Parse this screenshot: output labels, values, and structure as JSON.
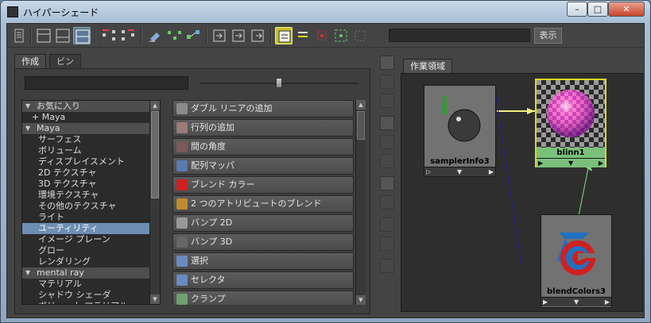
{
  "window": {
    "title": "ハイパーシェード",
    "controls": {
      "minimize": "–",
      "maximize": "□",
      "close": "✕"
    }
  },
  "toolbar": {
    "search_value": "",
    "show_label": "表示"
  },
  "tabs": [
    {
      "label": "作成"
    },
    {
      "label": "ビン"
    }
  ],
  "create": {
    "filter_value": "",
    "slider_value": 0.5
  },
  "tree": [
    {
      "label": "お気に入り",
      "kind": "header",
      "indent": 1
    },
    {
      "label": "+ Maya",
      "kind": "item",
      "indent": 2
    },
    {
      "label": "Maya",
      "kind": "header",
      "indent": 1
    },
    {
      "label": "サーフェス",
      "kind": "item",
      "indent": 3
    },
    {
      "label": "ボリューム",
      "kind": "item",
      "indent": 3
    },
    {
      "label": "ディスプレイスメント",
      "kind": "item",
      "indent": 3
    },
    {
      "label": "2D テクスチャ",
      "kind": "item",
      "indent": 3
    },
    {
      "label": "3D テクスチャ",
      "kind": "item",
      "indent": 3
    },
    {
      "label": "環境テクスチャ",
      "kind": "item",
      "indent": 3
    },
    {
      "label": "その他のテクスチャ",
      "kind": "item",
      "indent": 3
    },
    {
      "label": "ライト",
      "kind": "item",
      "indent": 3
    },
    {
      "label": "ユーティリティ",
      "kind": "selected",
      "indent": 3
    },
    {
      "label": "イメージ プレーン",
      "kind": "item",
      "indent": 3
    },
    {
      "label": "グロー",
      "kind": "item",
      "indent": 3
    },
    {
      "label": "レンダリング",
      "kind": "item",
      "indent": 3
    },
    {
      "label": "mental ray",
      "kind": "header",
      "indent": 1
    },
    {
      "label": "マテリアル",
      "kind": "item",
      "indent": 3
    },
    {
      "label": "シャドウ シェーダ",
      "kind": "item",
      "indent": 3
    },
    {
      "label": "ボリューム マテリアル",
      "kind": "item",
      "indent": 3
    }
  ],
  "nodes_list": [
    {
      "label": "ダブル リニアの追加",
      "icon": "add-double-linear-icon",
      "color": "#8a8a8a"
    },
    {
      "label": "行列の追加",
      "icon": "add-matrix-icon",
      "color": "#9a7a7a"
    },
    {
      "label": "間の角度",
      "icon": "angle-between-icon",
      "color": "#7a5a5a"
    },
    {
      "label": "配列マッパ",
      "icon": "array-mapper-icon",
      "color": "#5a7ab0"
    },
    {
      "label": "ブレンド カラー",
      "icon": "blend-colors-icon",
      "color": "#d02020"
    },
    {
      "label": "2 つのアトリビュートのブレンド",
      "icon": "blend-two-attr-icon",
      "color": "#c08a30"
    },
    {
      "label": "バンプ 2D",
      "icon": "bump-2d-icon",
      "color": "#999999"
    },
    {
      "label": "バンプ 3D",
      "icon": "bump-3d-icon",
      "color": "#666666"
    },
    {
      "label": "選択",
      "icon": "choice-icon",
      "color": "#6a8ac0"
    },
    {
      "label": "セレクタ",
      "icon": "chooser-icon",
      "color": "#6a8ac0"
    },
    {
      "label": "クランプ",
      "icon": "clamp-icon",
      "color": "#70a070"
    }
  ],
  "workspace": {
    "tab": "作業領域",
    "nodes": [
      {
        "name": "samplerInfo3",
        "icon": "sampler-info-icon",
        "selected": false
      },
      {
        "name": "blinn1",
        "icon": "blinn-material-icon",
        "selected": true
      },
      {
        "name": "blendColors3",
        "icon": "blend-colors-node-icon",
        "selected": false
      }
    ],
    "colors": {
      "selected_border": "#d8d820",
      "selected_label_bg": "#7ac07a",
      "connection_selected": "#f0f080",
      "connection_default": "#2020a0",
      "connection_green": "#80e080"
    },
    "port_glyphs": {
      "input": "▷",
      "down": "▼",
      "output": "▶"
    }
  }
}
